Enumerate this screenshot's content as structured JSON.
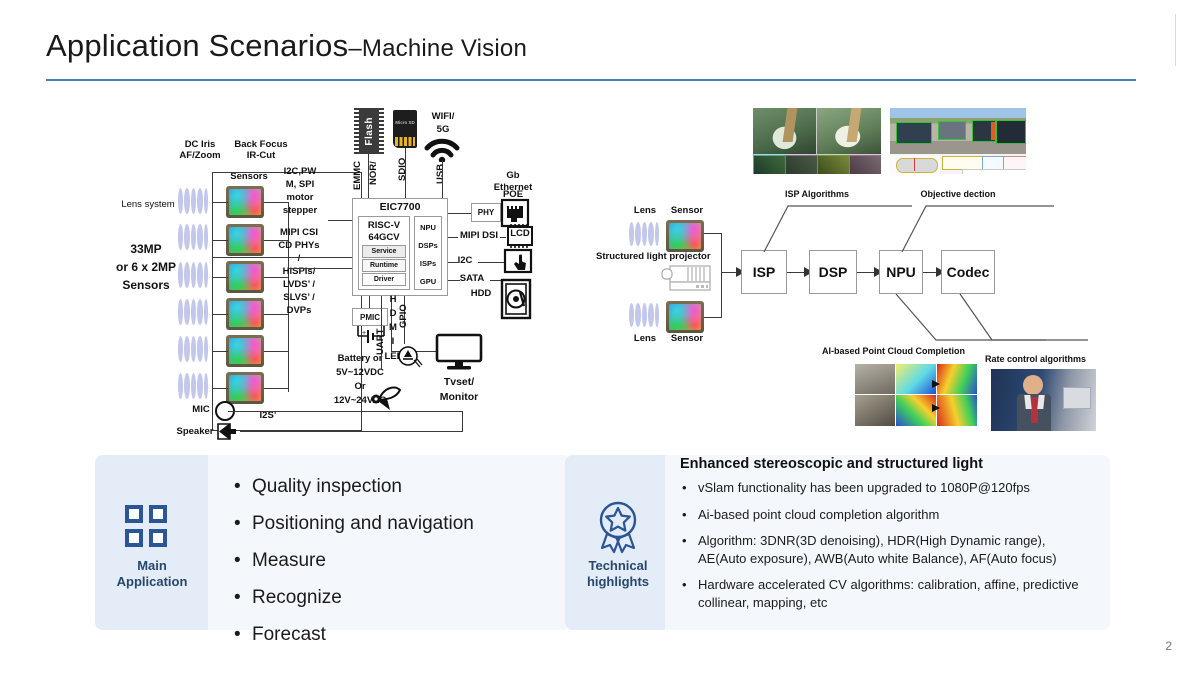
{
  "slide": {
    "title_main": "Application Scenarios",
    "title_sub": "–Machine Vision",
    "page_number": "2"
  },
  "left_diagram": {
    "labels": {
      "dc_iris": "DC Iris\nAF/Zoom",
      "dc_iris_l1": "DC Iris",
      "dc_iris_l2": "AF/Zoom",
      "back_focus_l1": "Back Focus",
      "back_focus_l2": "IR-Cut",
      "sensors": "Sensors",
      "lens_system": "Lens system",
      "mp_l1": "33MP",
      "mp_l2": "or 6 x 2MP",
      "mp_l3": "Sensors",
      "i2c_pwm": "I2C,PW\nM, SPI\nmotor\nstepper",
      "i2c_pwm_1": "I2C,PW",
      "i2c_pwm_2": "M, SPI",
      "i2c_pwm_3": "motor",
      "i2c_pwm_4": "stepper",
      "mipi_csi_1": "MIPI CSI",
      "mipi_csi_2": "CD PHYs",
      "slash": "/",
      "hispi_1": "HiSPIs/",
      "hispi_2": "LVDS’  /",
      "hispi_3": "SLVS’  /",
      "hispi_4": "DVPs",
      "mic": "MIC",
      "speaker": "Speaker",
      "i2s": "I2S’",
      "flash": "Flash",
      "emmc": "EMMC",
      "nor": "NOR/",
      "sdio": "SDIO",
      "usb": "USB",
      "wifi_1": "WIFI/",
      "wifi_2": "5G",
      "soc": "EIC7700",
      "cpu_1": "RISC-V",
      "cpu_2": "64GCV",
      "cpu_rows": [
        "Service",
        "Runtime",
        "Driver"
      ],
      "accels": [
        "NPU",
        "DSPs",
        "ISPs",
        "GPU"
      ],
      "phy": "PHY",
      "gb_eth_1": "Gb",
      "gb_eth_2": "Ethernet",
      "poe": "POE",
      "mipi_dsi": "MIPI DSI",
      "lcd": "LCD",
      "i2c": "I2C",
      "sata": "SATA",
      "hdd": "HDD",
      "hdmi": "H\nD\nM\nI",
      "hdmi_chars": [
        "H",
        "D",
        "M",
        "I"
      ],
      "tvset_1": "Tvset/",
      "tvset_2": "Monitor",
      "pmic": "PMIC",
      "uart": "UART",
      "gpio": "GPIO",
      "led": "LED",
      "battery_1": "Battery or",
      "battery_2": "5V~12VDC",
      "battery_3": "Or",
      "battery_4": "12V~24VAC"
    }
  },
  "right_diagram": {
    "pipeline": [
      "ISP",
      "DSP",
      "NPU",
      "Codec"
    ],
    "lens_top": "Lens",
    "sensor_top": "Sensor",
    "lens_bottom": "Lens",
    "sensor_bottom": "Sensor",
    "projector": "Structured light projector",
    "captions": {
      "isp_algorithms": "ISP Algorithms",
      "objective_detection": "Objective dection",
      "point_cloud": "AI-based Point Cloud Completion",
      "rate_control": "Rate control algorithms"
    },
    "detection_legend": [
      "Perspective\nKeypoints",
      "Boundary\nKeypoints",
      "Perspective\nKeypoints",
      "Boundary\nKeypoints",
      "3D Semantic Keypoints"
    ]
  },
  "panels": {
    "main": {
      "caption_line1": "Main",
      "caption_line2": "Application",
      "icon": "grid-squares-icon",
      "items": [
        "Quality inspection",
        "Positioning and navigation",
        "Measure",
        "Recognize",
        "Forecast"
      ]
    },
    "technical": {
      "caption_line1": "Technical",
      "caption_line2": "highlights",
      "icon": "award-star-icon",
      "heading": "Enhanced stereoscopic and structured light",
      "items": [
        "vSlam functionality has been upgraded to 1080P@120fps",
        "Ai-based point cloud completion algorithm",
        "Algorithm: 3DNR(3D denoising), HDR(High Dynamic range), AE(Auto exposure), AWB(Auto white Balance), AF(Auto focus)",
        "Hardware accelerated CV algorithms: calibration, affine, predictive collinear, mapping, etc"
      ]
    }
  },
  "colors": {
    "accent": "#4a7ebb",
    "panel_bg": "#e3ecf7",
    "panel_bg_light": "#f4f8fc",
    "caption": "#27486e",
    "icon_blue": "#2a5596"
  }
}
